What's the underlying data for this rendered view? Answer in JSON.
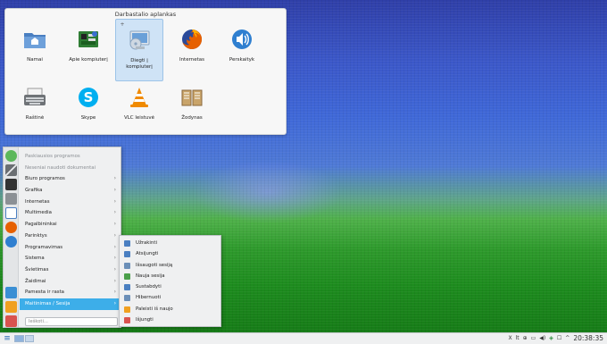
{
  "folder_view": {
    "title": "Darbastalio aplankas",
    "icons": [
      {
        "label": "Namai",
        "icon": "home-folder-icon",
        "color": "#4a7fc1",
        "selected": false
      },
      {
        "label": "Apie kompiuterį",
        "icon": "computer-board-icon",
        "color": "#3a8d3f",
        "selected": false
      },
      {
        "label": "Diegti į kompiuterį",
        "icon": "install-disc-icon",
        "color": "#6aa0d8",
        "selected": true
      },
      {
        "label": "Internetas",
        "icon": "firefox-icon",
        "color": "#e66000",
        "selected": false
      },
      {
        "label": "Perskaityk",
        "icon": "speaker-icon",
        "color": "#2f7fd0",
        "selected": false
      },
      {
        "label": "Raštinė",
        "icon": "typewriter-icon",
        "color": "#777a7d",
        "selected": false
      },
      {
        "label": "Skype",
        "icon": "skype-icon",
        "color": "#00aff0",
        "selected": false
      },
      {
        "label": "VLC leistuvė",
        "icon": "vlc-cone-icon",
        "color": "#f08a00",
        "selected": false
      },
      {
        "label": "Žodynas",
        "icon": "book-icon",
        "color": "#8b6a3e",
        "selected": false
      }
    ]
  },
  "app_menu": {
    "items": [
      {
        "label": "Paskiausios programos",
        "muted": true,
        "arrow": false
      },
      {
        "label": "Neseniai naudoti dokumentai",
        "muted": true,
        "arrow": false
      },
      {
        "label": "Biuro programos",
        "muted": false,
        "arrow": true
      },
      {
        "label": "Grafika",
        "muted": false,
        "arrow": true
      },
      {
        "label": "Internetas",
        "muted": false,
        "arrow": true
      },
      {
        "label": "Multimedia",
        "muted": false,
        "arrow": true
      },
      {
        "label": "Pagalbininkai",
        "muted": false,
        "arrow": true
      },
      {
        "label": "Parinktys",
        "muted": false,
        "arrow": true
      },
      {
        "label": "Programavimas",
        "muted": false,
        "arrow": true
      },
      {
        "label": "Sistema",
        "muted": false,
        "arrow": true
      },
      {
        "label": "Švietimas",
        "muted": false,
        "arrow": true
      },
      {
        "label": "Žaidimai",
        "muted": false,
        "arrow": true
      },
      {
        "label": "Pamesta ir rasta",
        "muted": false,
        "arrow": true
      },
      {
        "label": "Maitinimas / Sesija",
        "muted": false,
        "arrow": true,
        "active": true
      }
    ],
    "search_placeholder": "Ieškoti...",
    "favorites": [
      {
        "icon": "recent-arrow-icon",
        "color": "#5cb85c"
      },
      {
        "icon": "tools-icon",
        "color": "#6b6f73"
      },
      {
        "icon": "terminal-icon",
        "color": "#333333"
      },
      {
        "icon": "settings-icon",
        "color": "#6b6f73"
      },
      {
        "icon": "document-icon",
        "color": "#4a7fc1"
      },
      {
        "icon": "firefox-icon",
        "color": "#e66000"
      },
      {
        "icon": "speaker-icon",
        "color": "#2f7fd0"
      },
      {
        "icon": "download-icon",
        "color": "#3a8fd4"
      },
      {
        "icon": "package-icon",
        "color": "#f0a020"
      },
      {
        "icon": "power-icon",
        "color": "#d9534f"
      }
    ]
  },
  "session_menu": {
    "items": [
      {
        "label": "Užrakinti",
        "icon": "lock-icon",
        "color": "#4a7fc1"
      },
      {
        "label": "Atsijungti",
        "icon": "logout-icon",
        "color": "#4a7fc1"
      },
      {
        "label": "Išsaugoti sesiją",
        "icon": "save-session-icon",
        "color": "#6b8fb8"
      },
      {
        "label": "Nauja sesija",
        "icon": "new-session-icon",
        "color": "#4a9f4a"
      },
      {
        "label": "Sustabdyti",
        "icon": "suspend-icon",
        "color": "#4a7fc1"
      },
      {
        "label": "Hibernuoti",
        "icon": "hibernate-icon",
        "color": "#6b8fb8"
      },
      {
        "label": "Paleisti iš naujo",
        "icon": "restart-icon",
        "color": "#f0a020"
      },
      {
        "label": "Išjungti",
        "icon": "shutdown-icon",
        "color": "#d9534f"
      }
    ]
  },
  "taskbar": {
    "tray": [
      {
        "icon": "scissors-icon",
        "text": "X"
      },
      {
        "icon": "keyboard-layout-icon",
        "text": "lt"
      },
      {
        "icon": "network-icon",
        "text": "⊕"
      },
      {
        "icon": "storage-icon",
        "text": "▭"
      },
      {
        "icon": "volume-icon",
        "text": "◀)"
      },
      {
        "icon": "shield-icon",
        "text": "◈"
      },
      {
        "icon": "notifications-icon",
        "text": "☐"
      },
      {
        "icon": "expand-tray-icon",
        "text": "^"
      }
    ],
    "clock": "20:38:35",
    "menu_icon": "≡"
  },
  "colors": {
    "accent": "#3daee9",
    "panel": "#eff0f1"
  }
}
